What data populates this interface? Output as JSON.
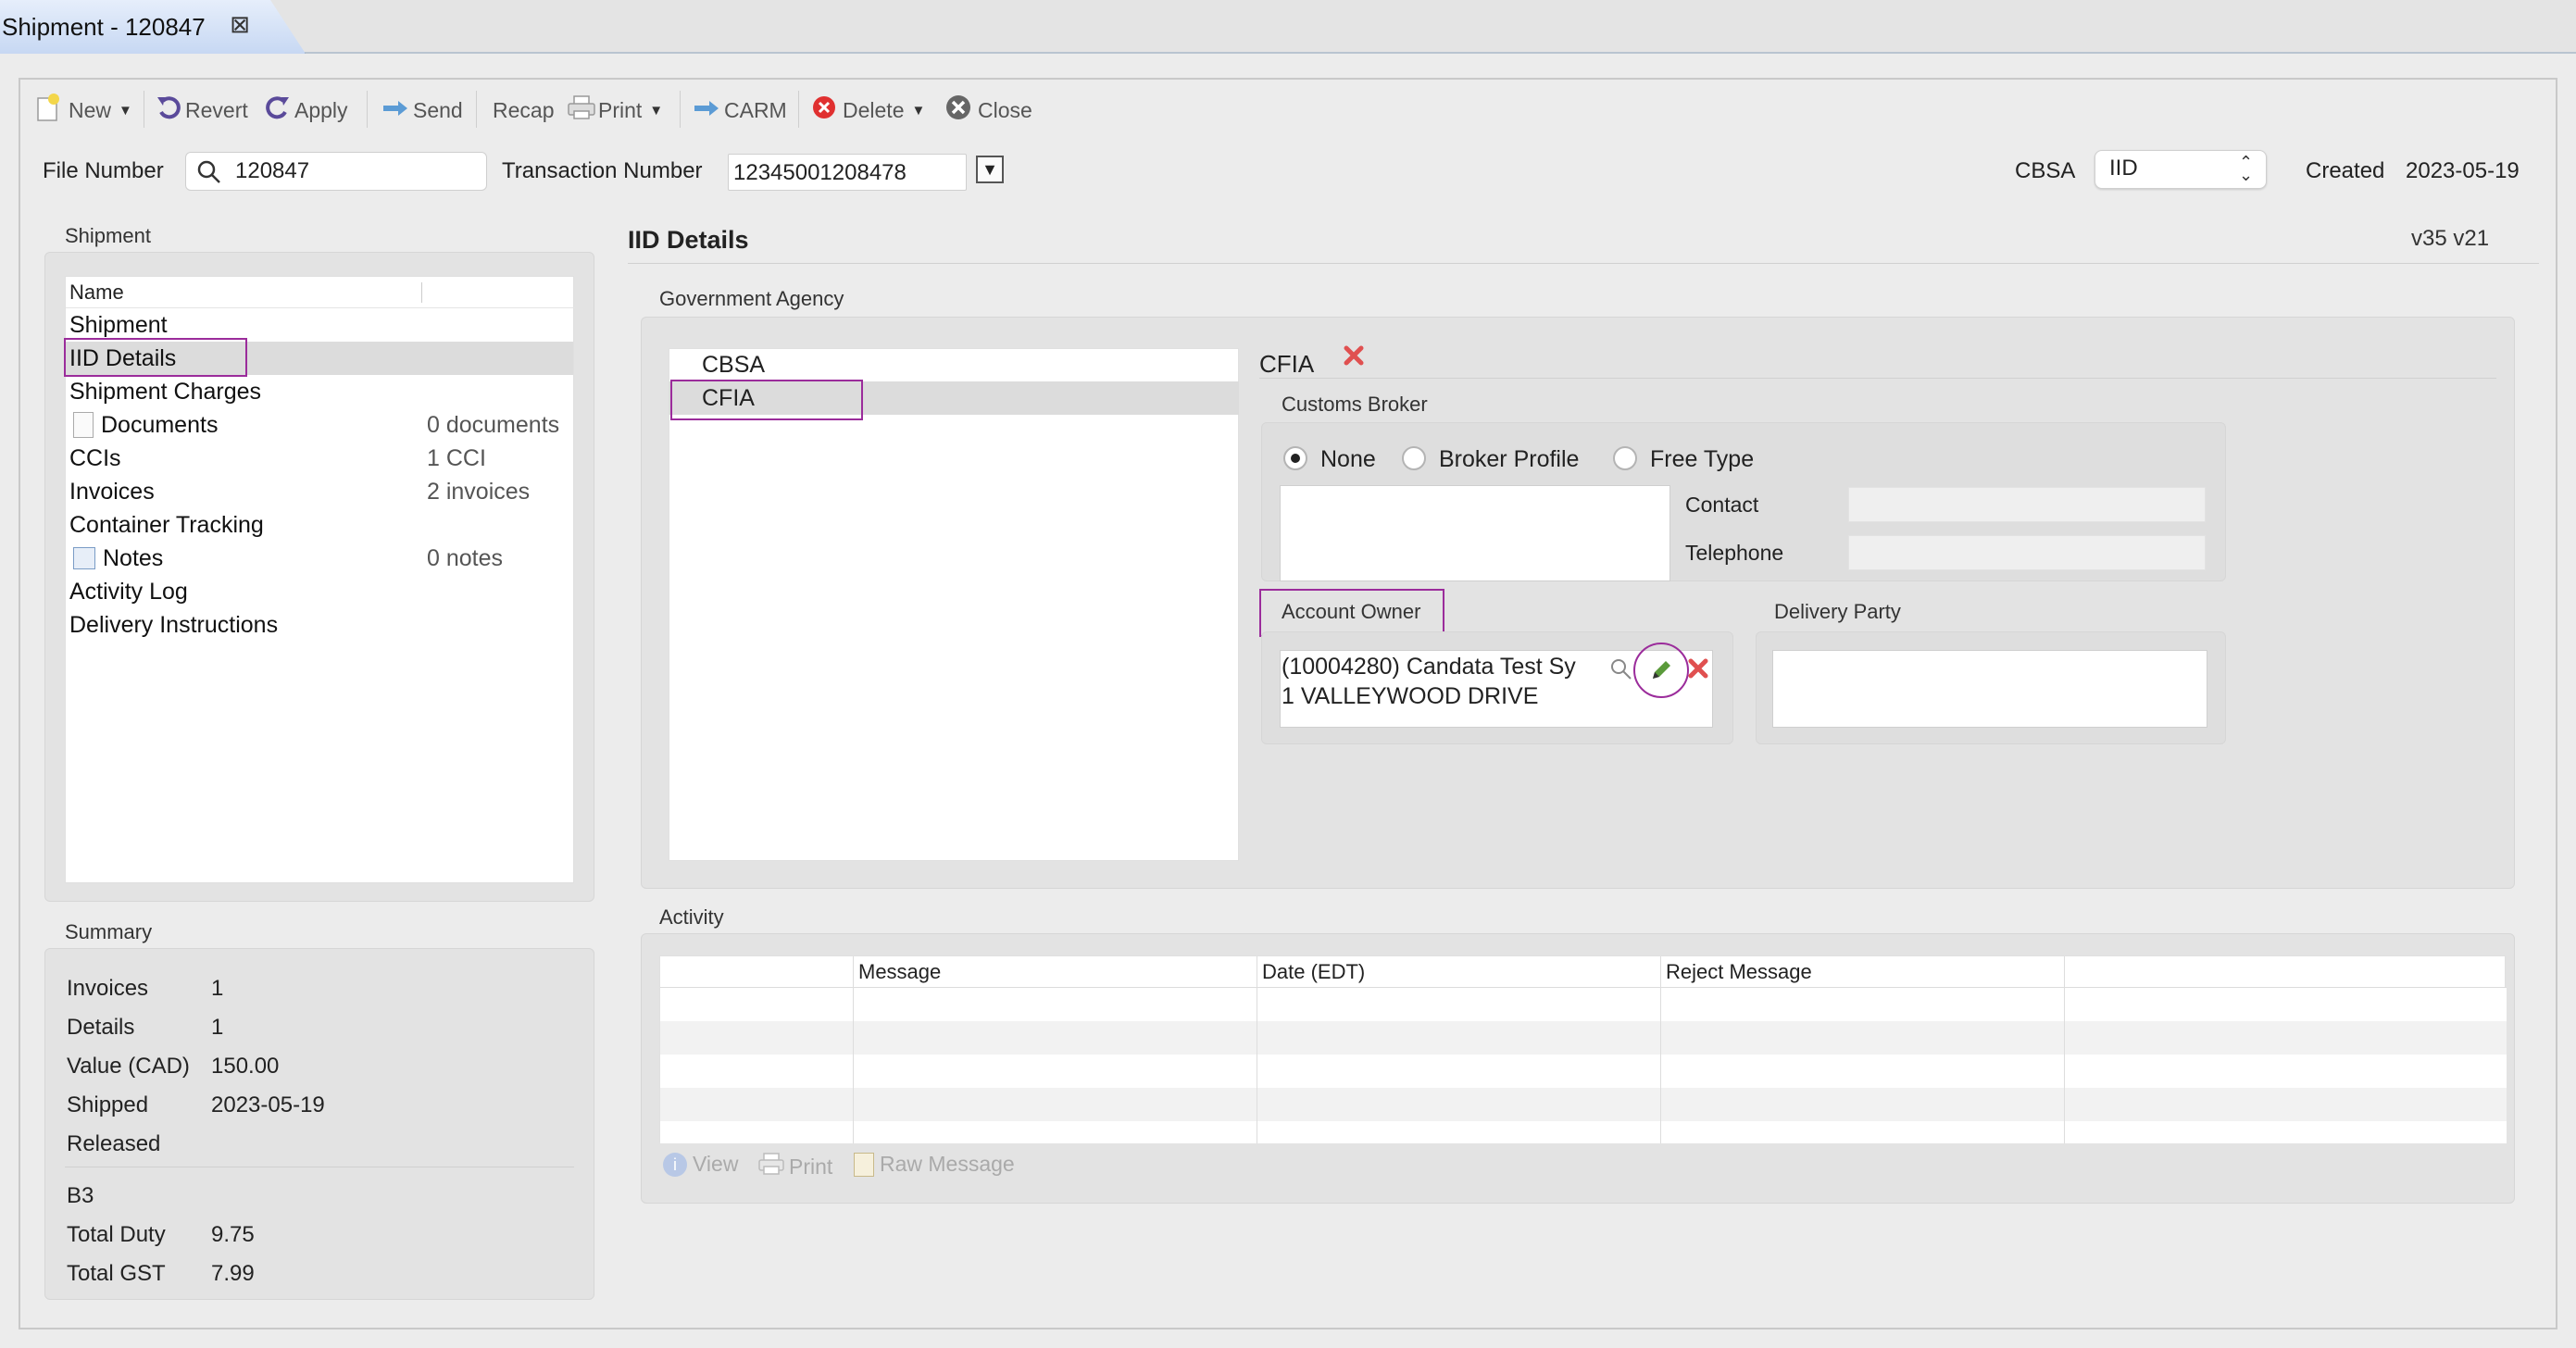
{
  "tab": {
    "title": "Shipment - 120847",
    "close": "⊠"
  },
  "toolbar": {
    "new": "New",
    "revert": "Revert",
    "apply": "Apply",
    "send": "Send",
    "recap": "Recap",
    "print": "Print",
    "carm": "CARM",
    "delete": "Delete",
    "close": "Close"
  },
  "header": {
    "file_number_label": "File Number",
    "file_number_value": "120847",
    "transaction_number_label": "Transaction Number",
    "transaction_number_value": "12345001208478",
    "cbsa_label": "CBSA",
    "cbsa_value": "IID",
    "created_label": "Created",
    "created_value": "2023-05-19"
  },
  "shipment_panel": {
    "title": "Shipment",
    "column_name": "Name",
    "items": [
      {
        "label": "Shipment",
        "count": ""
      },
      {
        "label": "IID Details",
        "count": ""
      },
      {
        "label": "Shipment Charges",
        "count": ""
      },
      {
        "label": "Documents",
        "count": "0 documents"
      },
      {
        "label": "CCIs",
        "count": "1 CCI"
      },
      {
        "label": "Invoices",
        "count": "2 invoices"
      },
      {
        "label": "Container Tracking",
        "count": ""
      },
      {
        "label": "Notes",
        "count": "0 notes"
      },
      {
        "label": "Activity Log",
        "count": ""
      },
      {
        "label": "Delivery Instructions",
        "count": ""
      }
    ]
  },
  "summary": {
    "title": "Summary",
    "rows": [
      {
        "label": "Invoices",
        "value": "1"
      },
      {
        "label": "Details",
        "value": "1"
      },
      {
        "label": "Value (CAD)",
        "value": "150.00"
      },
      {
        "label": "Shipped",
        "value": "2023-05-19"
      },
      {
        "label": "Released",
        "value": ""
      }
    ],
    "b3_label": "B3",
    "duty_label": "Total Duty",
    "duty_value": "9.75",
    "gst_label": "Total GST",
    "gst_value": "7.99"
  },
  "details": {
    "title": "IID Details",
    "version": "v35 v21",
    "gov_agency_title": "Government Agency",
    "agencies": [
      "CBSA",
      "CFIA"
    ],
    "selected_agency": "CFIA",
    "customs_broker_title": "Customs Broker",
    "radio_none": "None",
    "radio_broker_profile": "Broker Profile",
    "radio_free_type": "Free Type",
    "contact_label": "Contact",
    "telephone_label": "Telephone",
    "account_owner_title": "Account Owner",
    "account_owner_line1": "(10004280) Candata Test Sy",
    "account_owner_line2": "1 VALLEYWOOD DRIVE",
    "delivery_party_title": "Delivery Party"
  },
  "activity": {
    "title": "Activity",
    "columns": [
      "",
      "Message",
      "Date (EDT)",
      "Reject Message",
      ""
    ],
    "view": "View",
    "print": "Print",
    "raw_message": "Raw Message"
  },
  "colors": {
    "highlight": "#9b2c9b",
    "tab_blue": "#c7d8f3",
    "delete_red": "#e03030"
  }
}
